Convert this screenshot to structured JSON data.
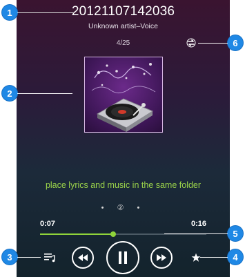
{
  "player": {
    "title": "20121107142036",
    "subtitle": "Unknown artist–Voice",
    "counter": "4/25",
    "lyrics": "place lyrics and music in the same folder",
    "page_indicator": "• ② •",
    "time_current": "0:07",
    "time_total": "0:16",
    "progress_fraction": 0.44
  },
  "controls": {
    "playlist_icon": "playlist-icon",
    "prev_icon": "rewind-icon",
    "play_pause_icon": "pause-icon",
    "next_icon": "fast-forward-icon",
    "favorite_icon": "star-icon",
    "repeat_icon": "repeat-icon"
  },
  "callouts": [
    "1",
    "2",
    "3",
    "4",
    "5",
    "6"
  ],
  "colors": {
    "accent": "#8fd33a",
    "callout": "#1f88e5",
    "lyrics": "#9ad24a"
  }
}
